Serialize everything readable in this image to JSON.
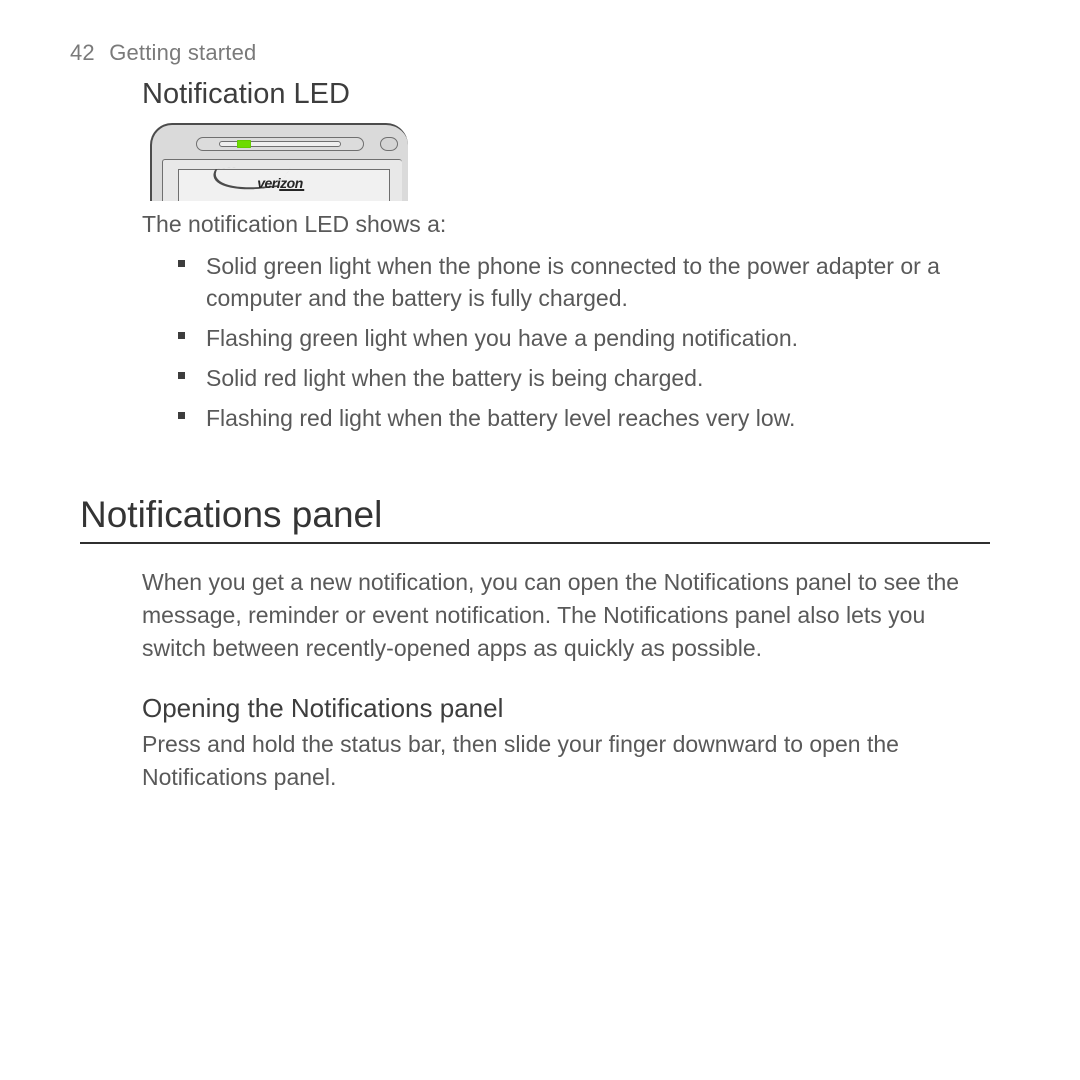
{
  "header": {
    "page_number": "42",
    "chapter": "Getting started"
  },
  "led_section": {
    "title": "Notification LED",
    "carrier_logo_text_a": "veri",
    "carrier_logo_text_b": "zon",
    "intro": "The notification LED shows a:",
    "bullets": [
      "Solid green light when the phone is connected to the power adapter or a computer and the battery is fully charged.",
      "Flashing green light when you have a pending notification.",
      "Solid red light when the battery is being charged.",
      "Flashing red light when the battery level reaches very low."
    ]
  },
  "panel_section": {
    "title": "Notifications panel",
    "body": "When you get a new notification, you can open the Notifications panel to see the message, reminder or event notification. The Notifications panel also lets you switch between recently-opened apps as quickly as possible.",
    "sub_title": "Opening the Notifications panel",
    "sub_body": "Press and hold the status bar, then slide your finger downward to open the Notifications panel."
  }
}
